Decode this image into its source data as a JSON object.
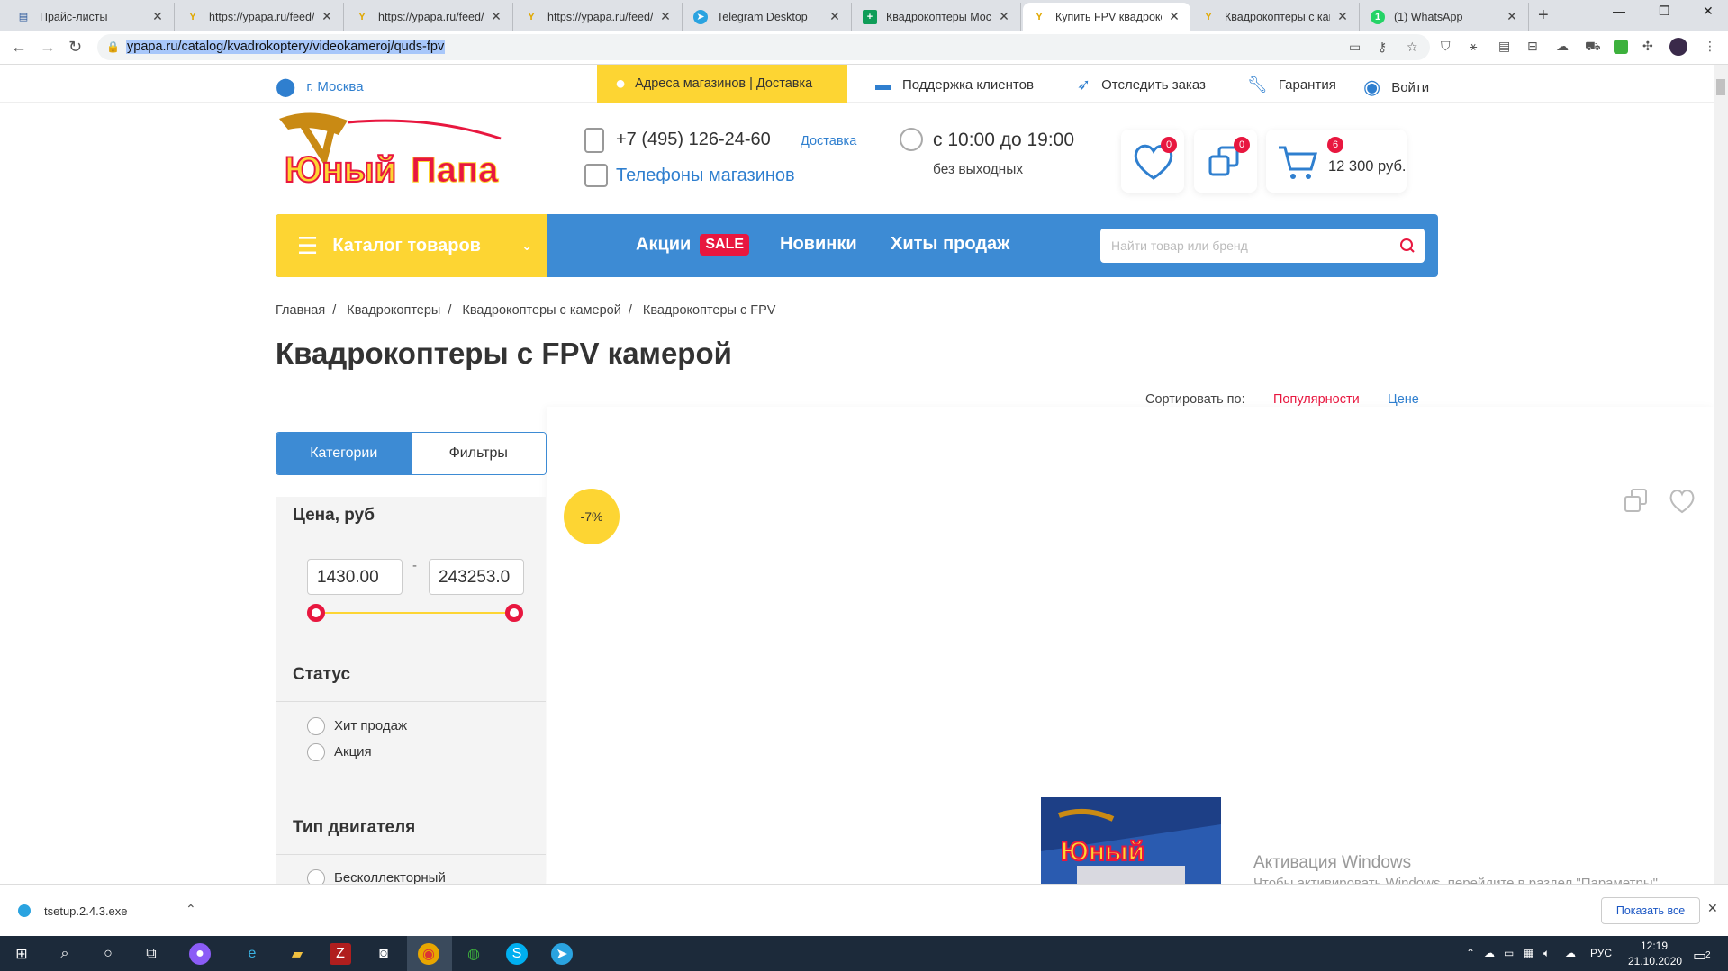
{
  "browser": {
    "tabs": [
      {
        "title": "Прайс-листы",
        "icon": "document-icon",
        "color": "#2b579a"
      },
      {
        "title": "https://ypapa.ru/feed/y",
        "icon": "ypapa-icon",
        "color": "#e0a800"
      },
      {
        "title": "https://ypapa.ru/feed/y",
        "icon": "ypapa-icon",
        "color": "#e0a800"
      },
      {
        "title": "https://ypapa.ru/feed/y",
        "icon": "ypapa-icon",
        "color": "#e0a800"
      },
      {
        "title": "Telegram Desktop",
        "icon": "telegram-icon",
        "color": "#2aa3e0"
      },
      {
        "title": "Квадрокоптеры Москв",
        "icon": "sheets-icon",
        "color": "#0f9d58"
      },
      {
        "title": "Купить FPV квадроко",
        "icon": "ypapa-icon",
        "color": "#e0a800"
      },
      {
        "title": "Квадрокоптеры с каме",
        "icon": "ypapa-icon",
        "color": "#e0a800"
      },
      {
        "title": "(1) WhatsApp",
        "icon": "whatsapp-icon",
        "color": "#25d366"
      }
    ],
    "url": "ypapa.ru/catalog/kvadrokoptery/videokameroj/quds-fpv"
  },
  "site": {
    "city": "г. Москва",
    "addresses": "Адреса магазинов | Доставка",
    "support": "Поддержка клиентов",
    "track": "Отследить заказ",
    "warranty": "Гарантия",
    "login": "Войти",
    "logo_text": "Юный Папа",
    "phone": "+7 (495) 126-24-60",
    "delivery": "Доставка",
    "store_phones": "Телефоны магазинов",
    "hours": "с 10:00 до 19:00",
    "days": "без выходных",
    "wishlist_count": "0",
    "compare_count": "0",
    "cart_count": "6",
    "cart_total": "12 300 руб."
  },
  "menu": {
    "catalog": "Каталог товаров",
    "promos": "Акции",
    "sale": "SALE",
    "new": "Новинки",
    "hits": "Хиты продаж",
    "search_placeholder": "Найти товар или бренд"
  },
  "breadcrumbs": [
    "Главная",
    "Квадрокоптеры",
    "Квадрокоптеры с камерой",
    "Квадрокоптеры с FPV"
  ],
  "page_title": "Квадрокоптеры с FPV камерой",
  "sort": {
    "label": "Сортировать по:",
    "popularity": "Популярности",
    "price": "Цене"
  },
  "filters": {
    "tab_categories": "Категории",
    "tab_filters": "Фильтры",
    "price_title": "Цена, руб",
    "price_min": "1430.00",
    "price_sep": "-",
    "price_max": "243253.0",
    "status_title": "Статус",
    "status_options": [
      "Хит продаж",
      "Акция"
    ],
    "engine_title": "Тип двигателя",
    "engine_options": [
      "Бесколлекторный"
    ]
  },
  "product": {
    "discount": "-7%"
  },
  "windows_activation": {
    "title": "Активация Windows",
    "text": "Чтобы активировать Windows, перейдите в раздел \"Параметры\"."
  },
  "download": {
    "file": "tsetup.2.4.3.exe",
    "show_all": "Показать все"
  },
  "taskbar": {
    "lang": "РУС",
    "time": "12:19",
    "date": "21.10.2020",
    "notif": "2"
  }
}
